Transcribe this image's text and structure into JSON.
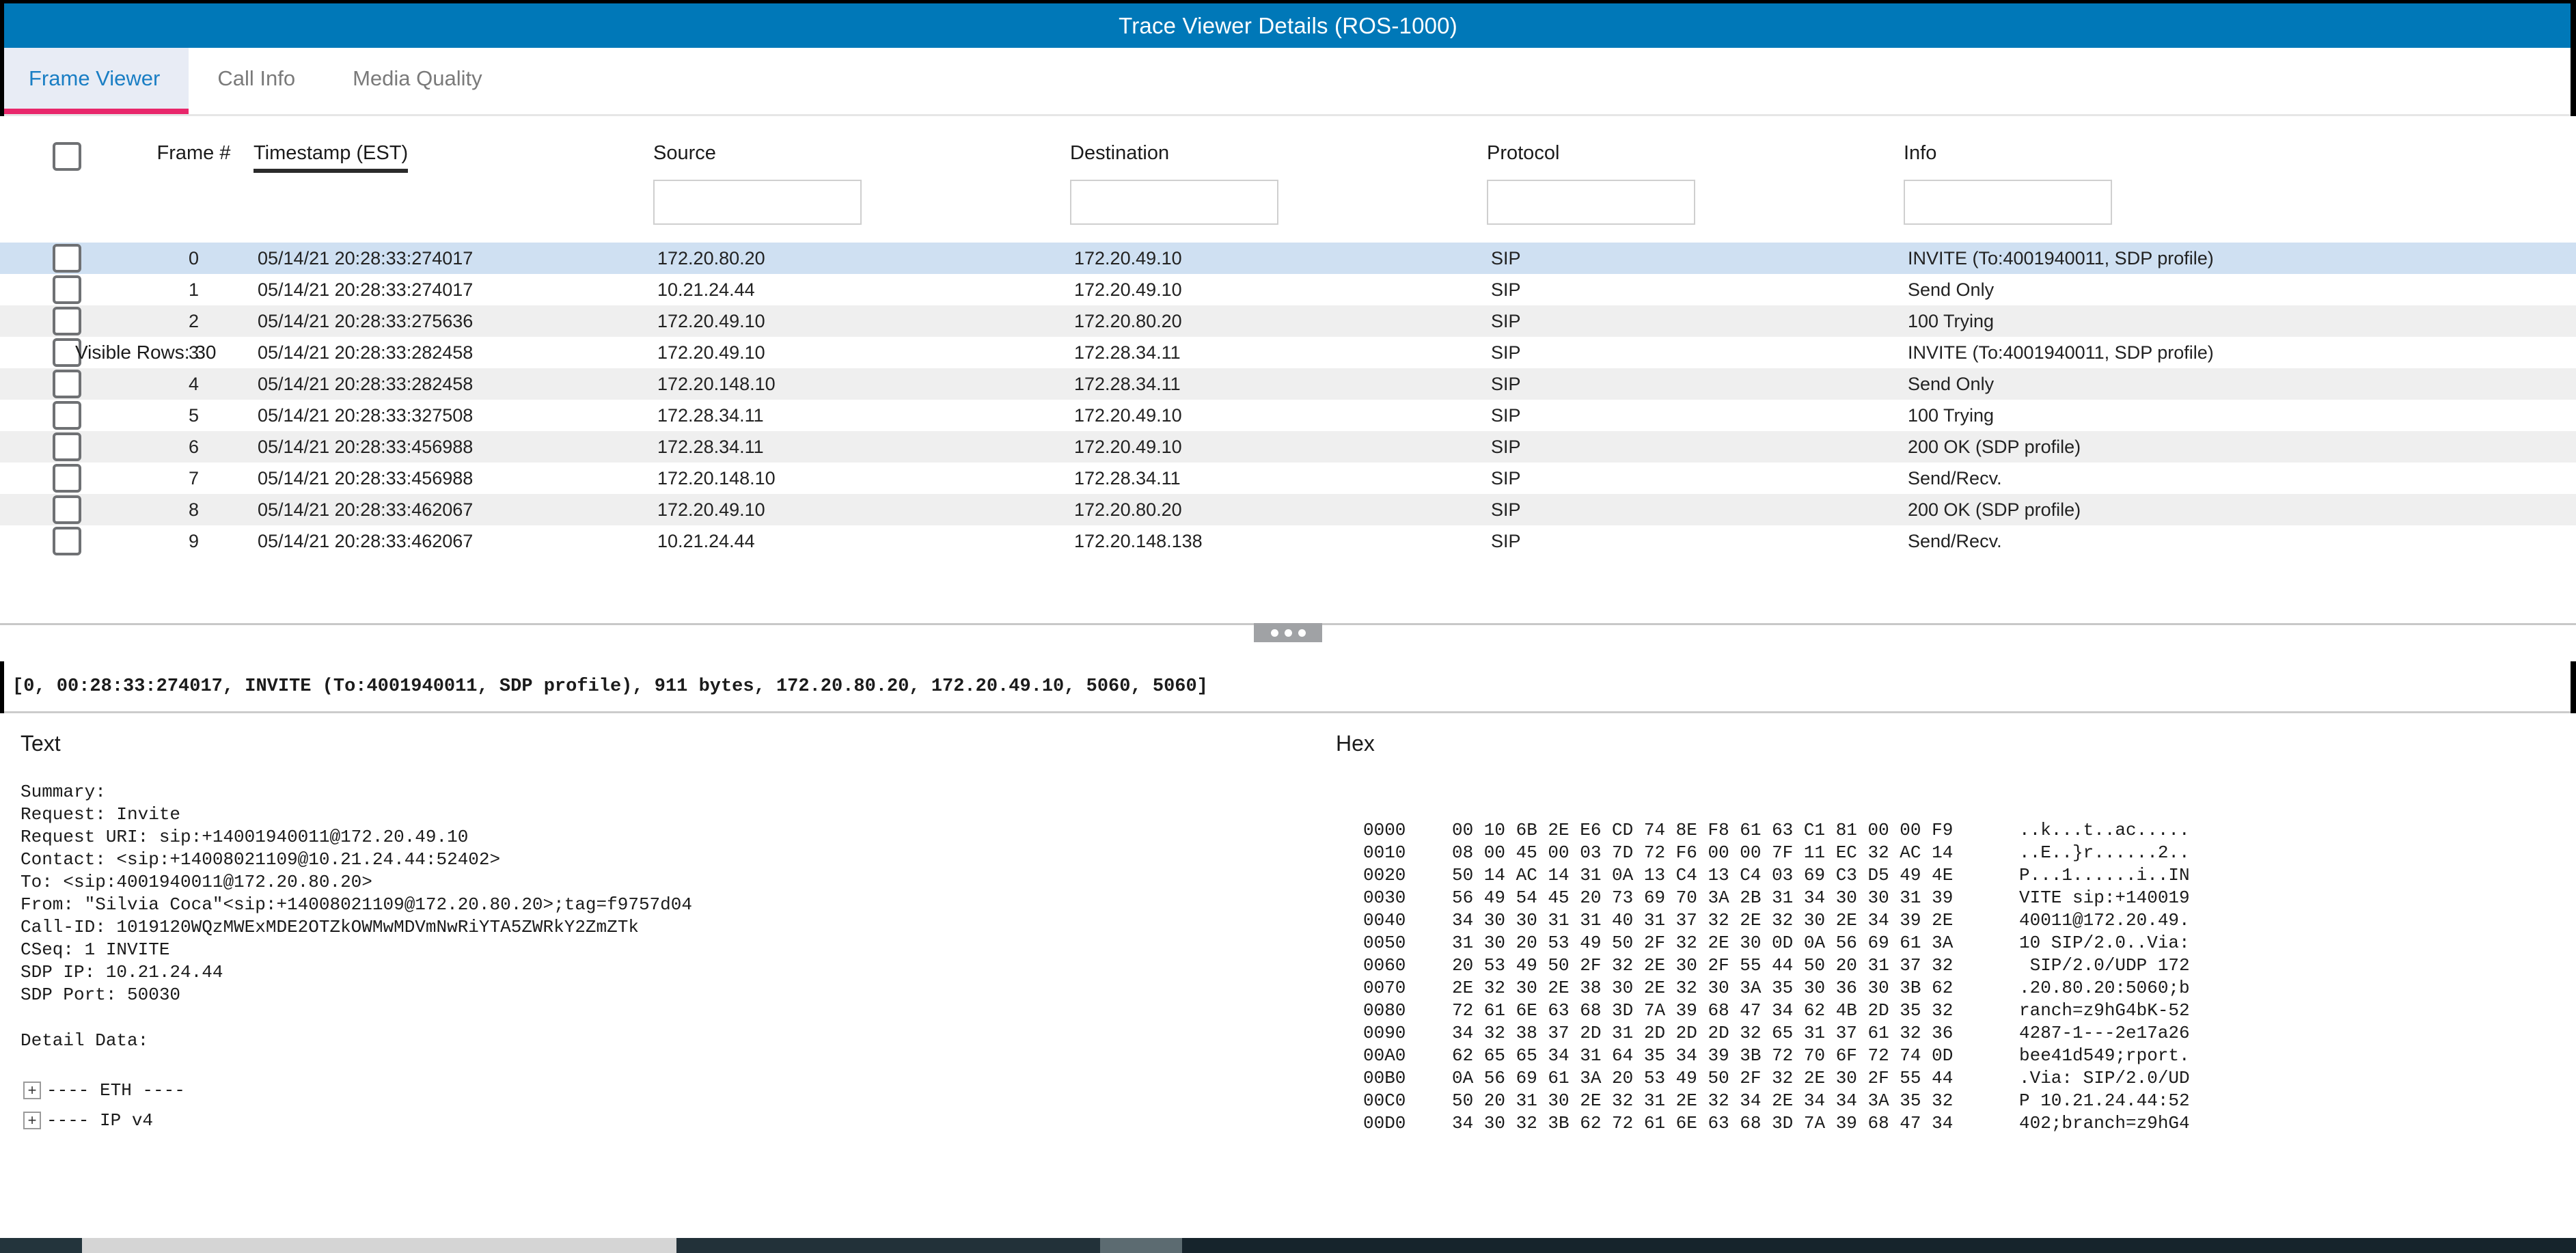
{
  "window": {
    "title": "Trace Viewer Details (ROS-1000)",
    "titlebar_color": "#0078b8"
  },
  "tabs": [
    {
      "label": "Frame Viewer",
      "active": true
    },
    {
      "label": "Call Info",
      "active": false
    },
    {
      "label": "Media Quality",
      "active": false
    }
  ],
  "table": {
    "visible_rows_label": "Visible Rows: 30",
    "sort_column": "Timestamp (EST)",
    "columns": [
      {
        "key": "check",
        "label": "",
        "filter": false,
        "align": "center"
      },
      {
        "key": "frame",
        "label": "Frame #",
        "filter": false,
        "align": "center"
      },
      {
        "key": "timestamp",
        "label": "Timestamp (EST)",
        "filter": false,
        "align": "left",
        "sorted": true
      },
      {
        "key": "source",
        "label": "Source",
        "filter": true,
        "align": "left"
      },
      {
        "key": "destination",
        "label": "Destination",
        "filter": true,
        "align": "left"
      },
      {
        "key": "protocol",
        "label": "Protocol",
        "filter": true,
        "align": "left"
      },
      {
        "key": "info",
        "label": "Info",
        "filter": true,
        "align": "left"
      }
    ],
    "filters": {
      "source": "",
      "destination": "",
      "protocol": "",
      "info": ""
    },
    "rows": [
      {
        "frame": "0",
        "timestamp": "05/14/21 20:28:33:274017",
        "source": "172.20.80.20",
        "destination": "172.20.49.10",
        "protocol": "SIP",
        "info": "INVITE (To:4001940011, SDP profile)",
        "selected": true,
        "alt": false,
        "checked": false
      },
      {
        "frame": "1",
        "timestamp": "05/14/21 20:28:33:274017",
        "source": "10.21.24.44",
        "destination": "172.20.49.10",
        "protocol": "SIP",
        "info": "Send Only",
        "selected": false,
        "alt": false,
        "checked": false
      },
      {
        "frame": "2",
        "timestamp": "05/14/21 20:28:33:275636",
        "source": "172.20.49.10",
        "destination": "172.20.80.20",
        "protocol": "SIP",
        "info": "100 Trying",
        "selected": false,
        "alt": true,
        "checked": false
      },
      {
        "frame": "3",
        "timestamp": "05/14/21 20:28:33:282458",
        "source": "172.20.49.10",
        "destination": "172.28.34.11",
        "protocol": "SIP",
        "info": "INVITE (To:4001940011, SDP profile)",
        "selected": false,
        "alt": false,
        "checked": false
      },
      {
        "frame": "4",
        "timestamp": "05/14/21 20:28:33:282458",
        "source": "172.20.148.10",
        "destination": "172.28.34.11",
        "protocol": "SIP",
        "info": "Send Only",
        "selected": false,
        "alt": true,
        "checked": false
      },
      {
        "frame": "5",
        "timestamp": "05/14/21 20:28:33:327508",
        "source": "172.28.34.11",
        "destination": "172.20.49.10",
        "protocol": "SIP",
        "info": "100 Trying",
        "selected": false,
        "alt": false,
        "checked": false
      },
      {
        "frame": "6",
        "timestamp": "05/14/21 20:28:33:456988",
        "source": "172.28.34.11",
        "destination": "172.20.49.10",
        "protocol": "SIP",
        "info": "200 OK (SDP profile)",
        "selected": false,
        "alt": true,
        "checked": false
      },
      {
        "frame": "7",
        "timestamp": "05/14/21 20:28:33:456988",
        "source": "172.20.148.10",
        "destination": "172.28.34.11",
        "protocol": "SIP",
        "info": "Send/Recv.",
        "selected": false,
        "alt": false,
        "checked": false
      },
      {
        "frame": "8",
        "timestamp": "05/14/21 20:28:33:462067",
        "source": "172.20.49.10",
        "destination": "172.20.80.20",
        "protocol": "SIP",
        "info": "200 OK (SDP profile)",
        "selected": false,
        "alt": true,
        "checked": false
      },
      {
        "frame": "9",
        "timestamp": "05/14/21 20:28:33:462067",
        "source": "10.21.24.44",
        "destination": "172.20.148.138",
        "protocol": "SIP",
        "info": "Send/Recv.",
        "selected": false,
        "alt": false,
        "checked": false
      }
    ]
  },
  "summary_line": "[0, 00:28:33:274017, INVITE (To:4001940011, SDP profile), 911 bytes, 172.20.80.20, 172.20.49.10, 5060, 5060]",
  "text_pane": {
    "title": "Text",
    "body": "Summary:\nRequest: Invite\nRequest URI: sip:+14001940011@172.20.49.10\nContact: <sip:+14008021109@10.21.24.44:52402>\nTo: <sip:4001940011@172.20.80.20>\nFrom: \"Silvia Coca\"<sip:+14008021109@172.20.80.20>;tag=f9757d04\nCall-ID: 1019120WQzMWExMDE2OTZkOWMwMDVmNwRiYTA5ZWRkY2ZmZTk\nCSeq: 1 INVITE\nSDP IP: 10.21.24.44\nSDP Port: 50030",
    "detail_data_label": "Detail Data:",
    "tree": [
      {
        "toggle": "+",
        "label": "---- ETH ----"
      },
      {
        "toggle": "+",
        "label": "---- IP v4"
      }
    ]
  },
  "hex_pane": {
    "title": "Hex",
    "rows": [
      {
        "offset": "0000",
        "bytes": "00 10 6B 2E E6 CD 74 8E F8 61 63 C1 81 00 00 F9",
        "ascii": "..k...t..ac....."
      },
      {
        "offset": "0010",
        "bytes": "08 00 45 00 03 7D 72 F6 00 00 7F 11 EC 32 AC 14",
        "ascii": "..E..}r......2.."
      },
      {
        "offset": "0020",
        "bytes": "50 14 AC 14 31 0A 13 C4 13 C4 03 69 C3 D5 49 4E",
        "ascii": "P...1......i..IN"
      },
      {
        "offset": "0030",
        "bytes": "56 49 54 45 20 73 69 70 3A 2B 31 34 30 30 31 39",
        "ascii": "VITE sip:+140019"
      },
      {
        "offset": "0040",
        "bytes": "34 30 30 31 31 40 31 37 32 2E 32 30 2E 34 39 2E",
        "ascii": "40011@172.20.49."
      },
      {
        "offset": "0050",
        "bytes": "31 30 20 53 49 50 2F 32 2E 30 0D 0A 56 69 61 3A",
        "ascii": "10 SIP/2.0..Via:"
      },
      {
        "offset": "0060",
        "bytes": "20 53 49 50 2F 32 2E 30 2F 55 44 50 20 31 37 32",
        "ascii": " SIP/2.0/UDP 172"
      },
      {
        "offset": "0070",
        "bytes": "2E 32 30 2E 38 30 2E 32 30 3A 35 30 36 30 3B 62",
        "ascii": ".20.80.20:5060;b"
      },
      {
        "offset": "0080",
        "bytes": "72 61 6E 63 68 3D 7A 39 68 47 34 62 4B 2D 35 32",
        "ascii": "ranch=z9hG4bK-52"
      },
      {
        "offset": "0090",
        "bytes": "34 32 38 37 2D 31 2D 2D 2D 32 65 31 37 61 32 36",
        "ascii": "4287-1---2e17a26"
      },
      {
        "offset": "00A0",
        "bytes": "62 65 65 34 31 64 35 34 39 3B 72 70 6F 72 74 0D",
        "ascii": "bee41d549;rport."
      },
      {
        "offset": "00B0",
        "bytes": "0A 56 69 61 3A 20 53 49 50 2F 32 2E 30 2F 55 44",
        "ascii": ".Via: SIP/2.0/UD"
      },
      {
        "offset": "00C0",
        "bytes": "50 20 31 30 2E 32 31 2E 32 34 2E 34 34 3A 35 32",
        "ascii": "P 10.21.24.44:52"
      },
      {
        "offset": "00D0",
        "bytes": "34 30 32 3B 62 72 61 6E 63 68 3D 7A 39 68 47 34",
        "ascii": "402;branch=z9hG4"
      }
    ]
  }
}
